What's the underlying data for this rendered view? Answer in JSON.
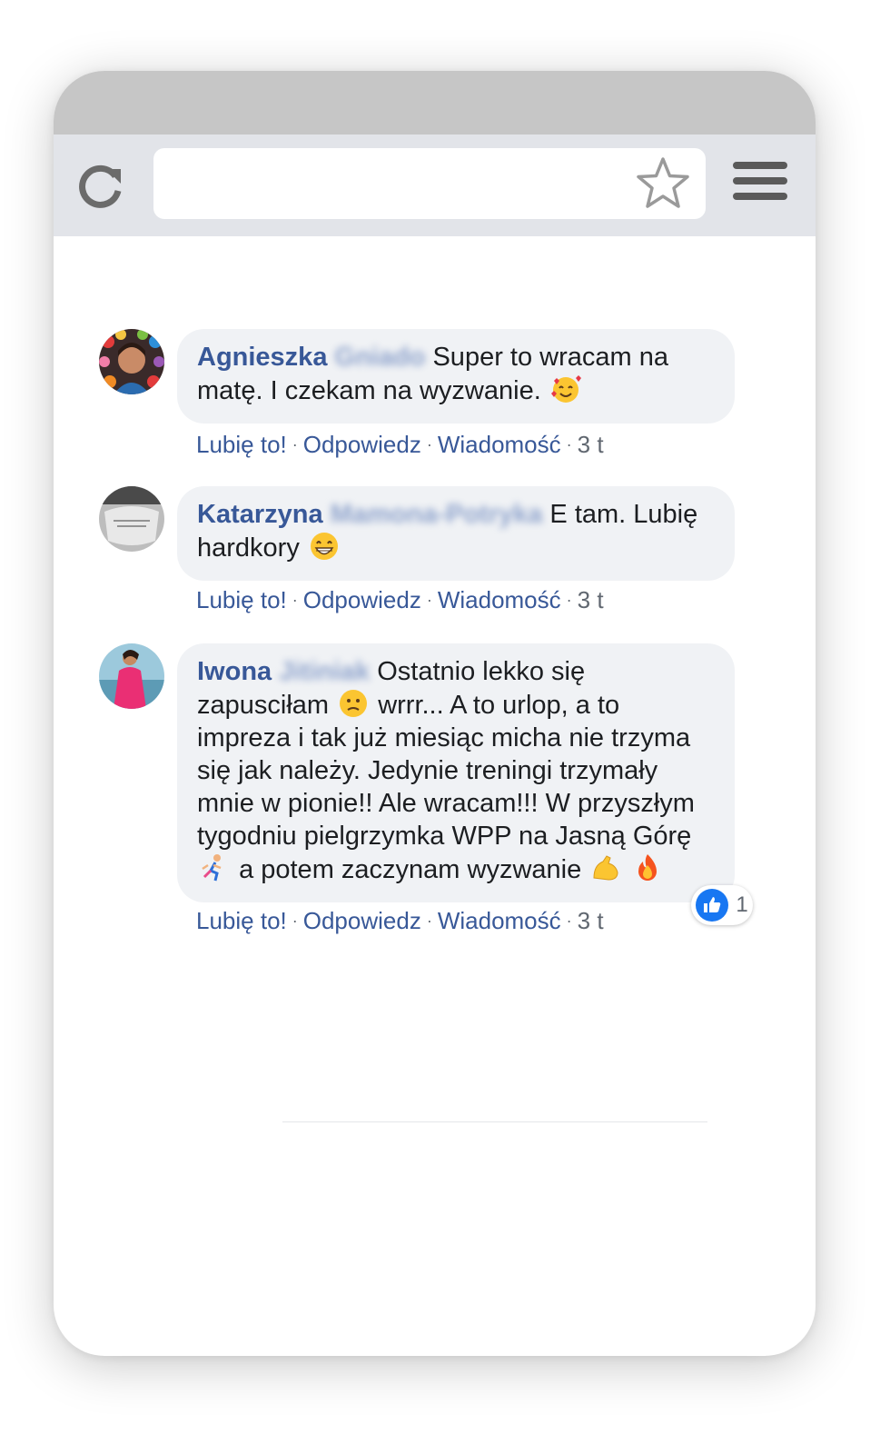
{
  "browser": {
    "reload_icon": "reload-icon",
    "star_icon": "star-icon",
    "menu_icon": "hamburger-menu-icon"
  },
  "comments": [
    {
      "first_name": "Agnieszka",
      "last_name": "Gniado",
      "text_before_emoji": "Super to wracam na matę. I czekam na wyzwanie.",
      "emoji": "smiling-face-with-hearts",
      "actions": {
        "like": "Lubię to!",
        "reply": "Odpowiedz",
        "message": "Wiadomość",
        "time": "3 t"
      }
    },
    {
      "first_name": "Katarzyna",
      "last_name": "Mamona-Potryka",
      "text_before_emoji": "E tam. Lubię hardkory",
      "emoji": "grinning-face",
      "actions": {
        "like": "Lubię to!",
        "reply": "Odpowiedz",
        "message": "Wiadomość",
        "time": "3 t"
      }
    },
    {
      "first_name": "Iwona",
      "last_name": "Jitiniak",
      "text_part1": "Ostatnio lekko się zapusciłam",
      "text_part2": "wrrr... A to urlop, a to impreza i tak już miesiąc micha nie trzyma się jak należy. Jedynie treningi trzymały mnie w pionie!! Ale wracam!!! W przyszłym tygodniu pielgrzymka WPP na Jasną Górę",
      "text_part3": "a potem zaczynam wyzwanie",
      "actions": {
        "like": "Lubię to!",
        "reply": "Odpowiedz",
        "message": "Wiadomość",
        "time": "3 t"
      },
      "reaction_count": "1",
      "reaction_icon": "thumbs-up-icon"
    }
  ],
  "colors": {
    "link": "#385898",
    "bubble": "#f0f2f5",
    "like_blue": "#1877f2"
  }
}
